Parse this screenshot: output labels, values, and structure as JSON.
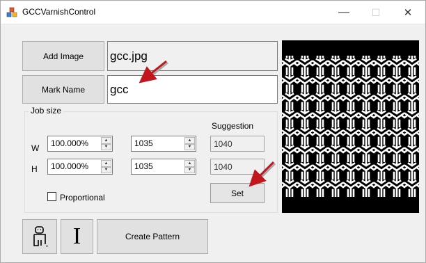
{
  "window": {
    "title": "GCCVarnishControl",
    "minimize_glyph": "—",
    "maximize_glyph": "☐",
    "close_glyph": "✕"
  },
  "buttons": {
    "add_image": "Add Image",
    "mark_name": "Mark Name",
    "set": "Set",
    "create_pattern": "Create Pattern",
    "text_tool_glyph": "I"
  },
  "fields": {
    "image_file": "gcc.jpg",
    "mark_name_value": "gcc"
  },
  "job_size": {
    "group_label": "Job size",
    "suggestion_label": "Suggestion",
    "width": {
      "label": "W",
      "percent": "100.000%",
      "value": "1035",
      "suggestion": "1040"
    },
    "height": {
      "label": "H",
      "percent": "100.000%",
      "value": "1035",
      "suggestion": "1040"
    },
    "proportional_label": "Proportional",
    "proportional_checked": false
  },
  "icons": {
    "app": "app-cubes-icon",
    "person_tool": "person-dropdown-icon",
    "text_cursor": "text-cursor-icon",
    "annotation_arrow": "red-arrow-icon"
  },
  "colors": {
    "annotation_arrow": "#c0161c",
    "preview_background": "#000000",
    "preview_pattern": "#ffffff"
  }
}
